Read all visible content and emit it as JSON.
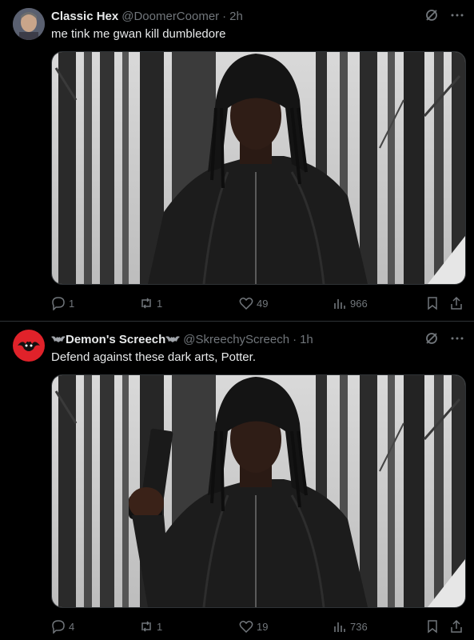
{
  "tweets": [
    {
      "name": "Classic Hex",
      "handle": "@DoomerCoomer",
      "separator": "·",
      "time": "2h",
      "text": "me tink me gwan kill dumbledore",
      "metrics": {
        "replies": "1",
        "reposts": "1",
        "likes": "49",
        "views": "966"
      },
      "has_gun": false
    },
    {
      "name": "Demon's Screech",
      "name_prefix_icon": "bat-emoji",
      "handle": "@SkreechyScreech",
      "separator": "·",
      "time": "1h",
      "text": "Defend against these dark arts, Potter.",
      "metrics": {
        "replies": "4",
        "reposts": "1",
        "likes": "19",
        "views": "736"
      },
      "has_gun": true
    }
  ],
  "colors": {
    "background": "#000000",
    "text": "#e7e9ea",
    "muted": "#71767b",
    "divider": "#2f3336",
    "demon_avatar": "#e0222a"
  }
}
